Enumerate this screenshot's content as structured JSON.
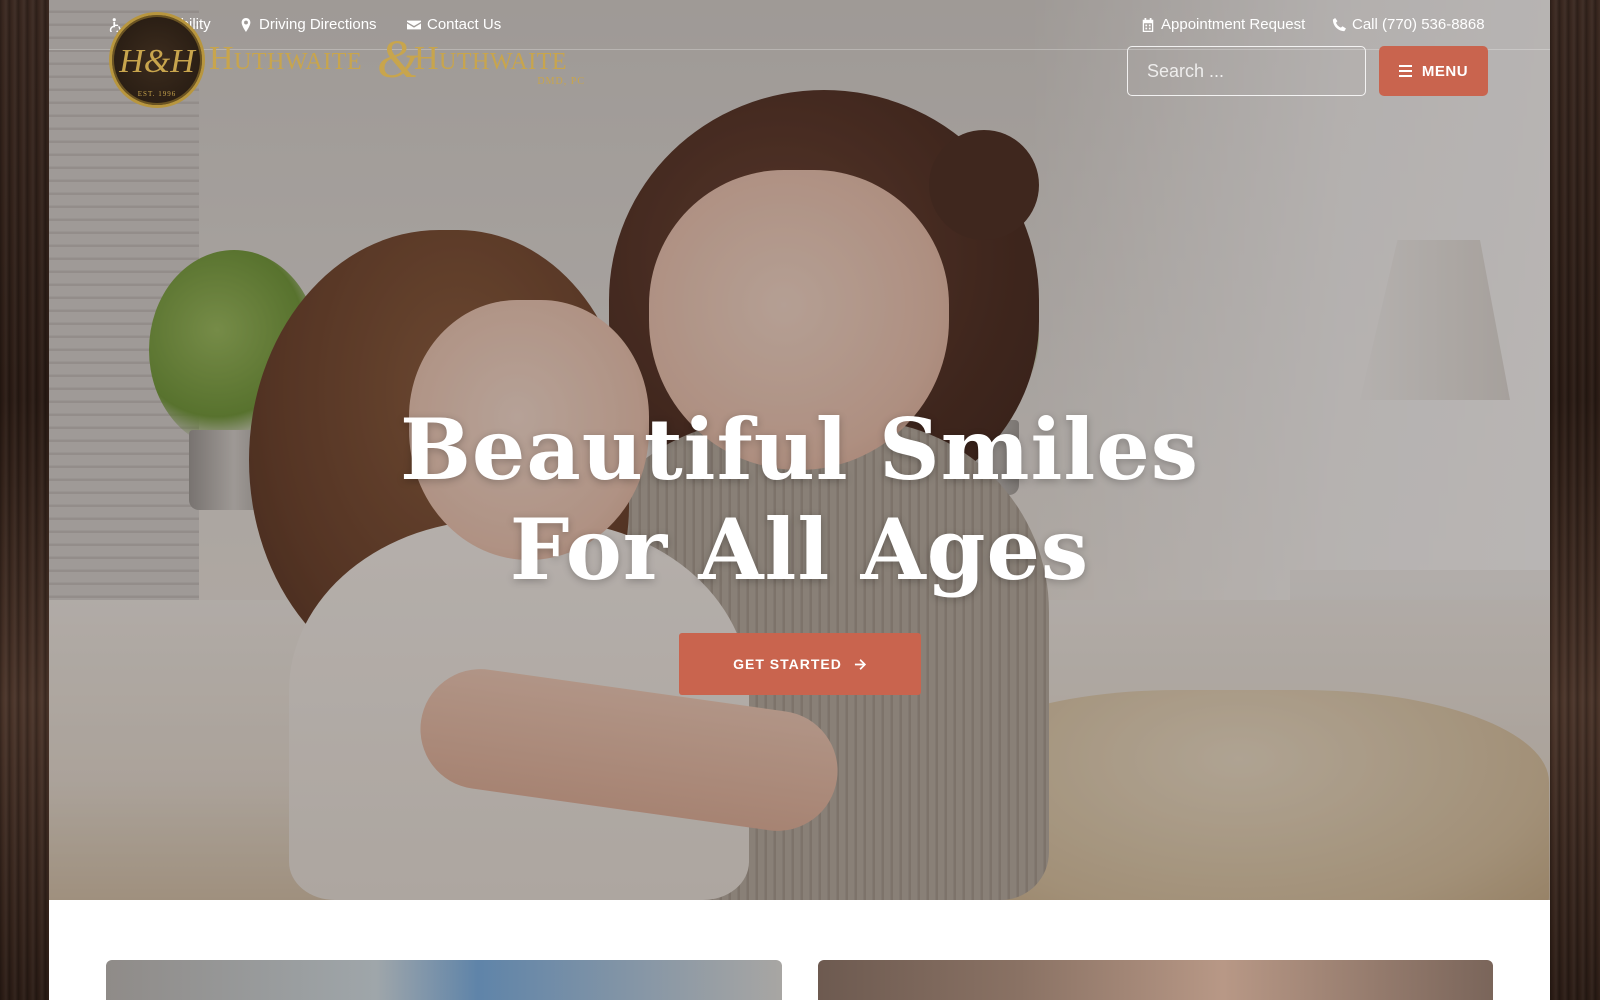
{
  "utility_left": [
    {
      "label": "Accessibility",
      "icon": "wheelchair-icon"
    },
    {
      "label": "Driving Directions",
      "icon": "map-marker-icon"
    },
    {
      "label": "Contact Us",
      "icon": "envelope-icon"
    }
  ],
  "utility_right": [
    {
      "label": "Appointment Request",
      "icon": "calendar-icon"
    },
    {
      "label": "Call (770) 536-8868",
      "icon": "phone-icon"
    }
  ],
  "logo": {
    "monogram": "H&H",
    "name_left": "Huthwaite",
    "ampersand": "&",
    "name_right": "Huthwaite",
    "suffix": "DMD, PC",
    "est": "EST. 1996"
  },
  "search": {
    "placeholder": "Search ..."
  },
  "menu": {
    "label": "MENU"
  },
  "hero": {
    "headline_line1": "Beautiful Smiles",
    "headline_line2": "For All Ages",
    "cta_label": "GET STARTED"
  },
  "colors": {
    "accent": "#c9644e",
    "logo_gold": "#c8a54d"
  }
}
